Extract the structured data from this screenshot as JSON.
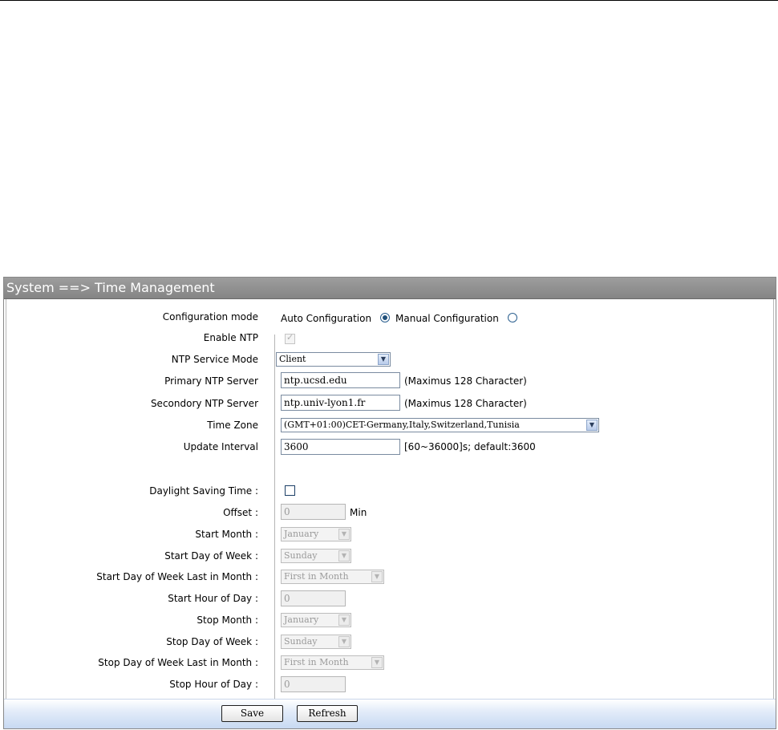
{
  "header": {
    "title": "System ==> Time Management"
  },
  "config": {
    "label": "Configuration mode",
    "auto_label": "Auto Configuration",
    "manual_label": "Manual Configuration",
    "selected": "auto"
  },
  "ntp": {
    "enable_label": "Enable NTP",
    "enable_checked": true,
    "service_mode_label": "NTP Service Mode",
    "service_mode_value": "Client",
    "primary_label": "Primary NTP Server",
    "primary_value": "ntp.ucsd.edu",
    "primary_hint": "(Maximus 128 Character)",
    "secondary_label": "Secondory NTP Server",
    "secondary_value": "ntp.univ-lyon1.fr",
    "secondary_hint": "(Maximus 128 Character)",
    "timezone_label": "Time Zone",
    "timezone_value": "(GMT+01:00)CET-Germany,Italy,Switzerland,Tunisia",
    "interval_label": "Update Interval",
    "interval_value": "3600",
    "interval_hint": "[60~36000]s; default:3600"
  },
  "dst": {
    "enable_label": "Daylight Saving Time :",
    "enabled": false,
    "offset_label": "Offset :",
    "offset_value": "0",
    "offset_unit": "Min",
    "start_month_label": "Start Month :",
    "start_month_value": "January",
    "start_dow_label": "Start Day of Week :",
    "start_dow_value": "Sunday",
    "start_last_label": "Start Day of Week Last in Month :",
    "start_last_value": "First in Month",
    "start_hour_label": "Start Hour of Day :",
    "start_hour_value": "0",
    "stop_month_label": "Stop Month :",
    "stop_month_value": "January",
    "stop_dow_label": "Stop Day of Week :",
    "stop_dow_value": "Sunday",
    "stop_last_label": "Stop Day of Week Last in Month :",
    "stop_last_value": "First in Month",
    "stop_hour_label": "Stop Hour of Day :",
    "stop_hour_value": "0"
  },
  "buttons": {
    "save": "Save",
    "refresh": "Refresh"
  },
  "icons": {
    "dropdown": "chevron-down-icon",
    "radio_on": "radio-selected-icon",
    "radio_off": "radio-unselected-icon"
  }
}
